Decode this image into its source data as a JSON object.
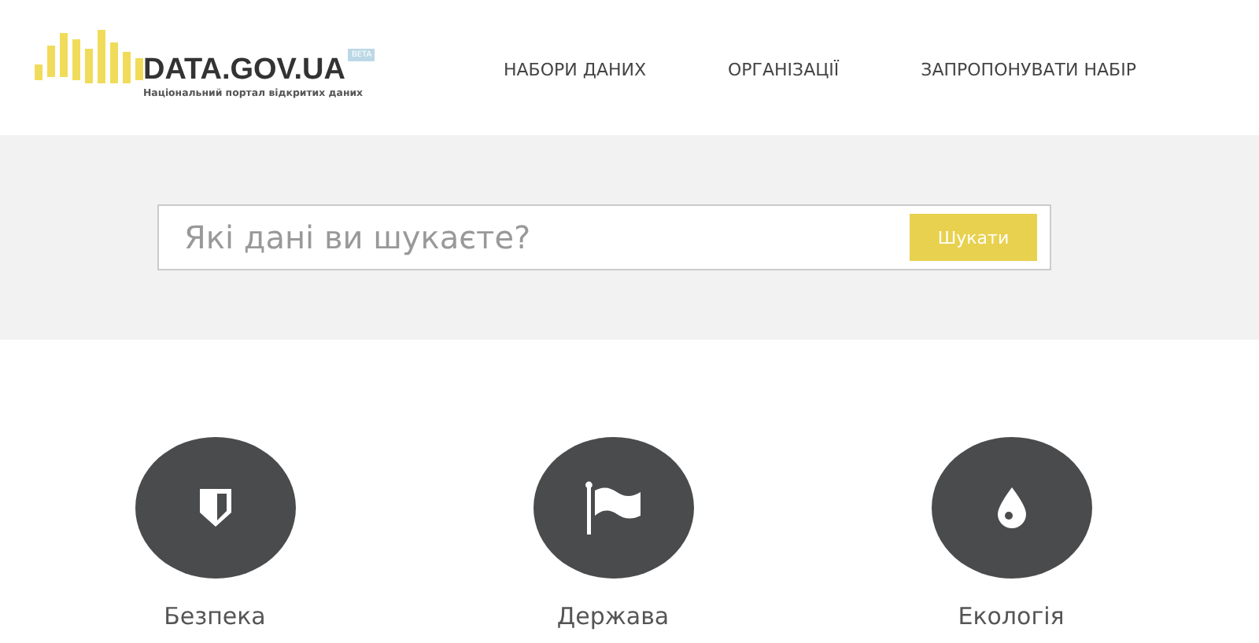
{
  "logo": {
    "title": "DATA.GOV.UA",
    "badge": "BETA",
    "subtitle": "Національний портал відкритих даних"
  },
  "nav": [
    {
      "label": "НАБОРИ ДАНИХ"
    },
    {
      "label": "ОРГАНІЗАЦІЇ"
    },
    {
      "label": "ЗАПРОПОНУВАТИ НАБІР"
    }
  ],
  "search": {
    "placeholder": "Які дані ви шукаєте?",
    "button": "Шукати"
  },
  "categories": [
    {
      "label": "Безпека"
    },
    {
      "label": "Держава"
    },
    {
      "label": "Екологія"
    }
  ]
}
